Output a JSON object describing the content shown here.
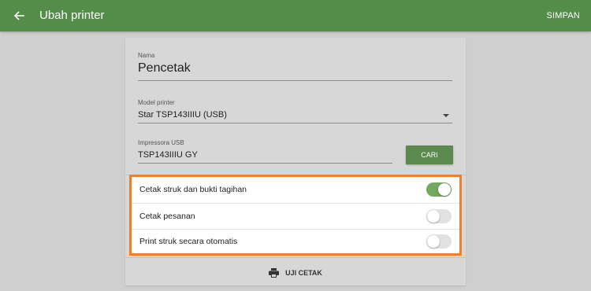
{
  "appbar": {
    "title": "Ubah printer",
    "save_label": "SIMPAN",
    "back_icon": "arrow-left-icon",
    "background": "#548c4a"
  },
  "form": {
    "name": {
      "label": "Nama",
      "value": "Pencetak"
    },
    "model": {
      "label": "Model printer",
      "value": "Star TSP143IIIU (USB)"
    },
    "usb": {
      "label": "Impressora USB",
      "value": "TSP143IIIU GY"
    },
    "search_label": "CARI"
  },
  "toggles": [
    {
      "label": "Cetak struk dan bukti tagihan",
      "on": true
    },
    {
      "label": "Cetak pesanan",
      "on": false
    },
    {
      "label": "Print struk secara otomatis",
      "on": false
    }
  ],
  "highlight_color": "#f07f2b",
  "test_print": {
    "label": "UJI CETAK",
    "icon": "printer-icon"
  }
}
